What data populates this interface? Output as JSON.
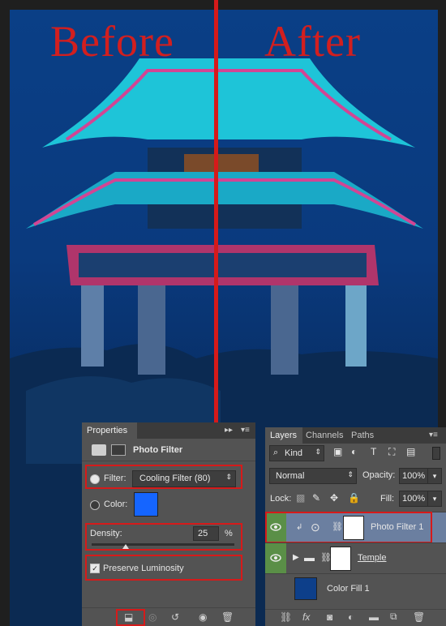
{
  "overlay": {
    "before_label": "Before",
    "after_label": "After"
  },
  "colors": {
    "accent_red": "#d61a1a",
    "filter_color": "#1565ff",
    "eye_green": "#5a8f47",
    "color_fill": "#0d3f8a"
  },
  "properties": {
    "tab": "Properties",
    "header_title": "Photo Filter",
    "filter_label": "Filter:",
    "filter_value": "Cooling Filter (80)",
    "color_label": "Color:",
    "density_label": "Density:",
    "density_value": "25",
    "density_unit": "%",
    "density_level_percent": 25,
    "preserve_label": "Preserve Luminosity",
    "preserve_checked": true,
    "icons": [
      "clip-to-layer-icon",
      "view-previous-icon",
      "reset-icon",
      "visibility-icon",
      "delete-icon"
    ]
  },
  "layers": {
    "tabs": [
      "Layers",
      "Channels",
      "Paths"
    ],
    "kind_label": "Kind",
    "blend_mode": "Normal",
    "opacity_label": "Opacity:",
    "opacity_value": "100%",
    "lock_label": "Lock:",
    "fill_label": "Fill:",
    "fill_value": "100%",
    "items": [
      {
        "name": "Photo Filter 1",
        "selected": true
      },
      {
        "name": "Temple",
        "selected": false
      },
      {
        "name": "Color Fill 1",
        "selected": false
      }
    ],
    "footer_icons": [
      "link-icon",
      "fx-icon",
      "mask-icon",
      "adjustment-icon",
      "group-folder-icon",
      "new-layer-icon",
      "trash-icon"
    ]
  }
}
